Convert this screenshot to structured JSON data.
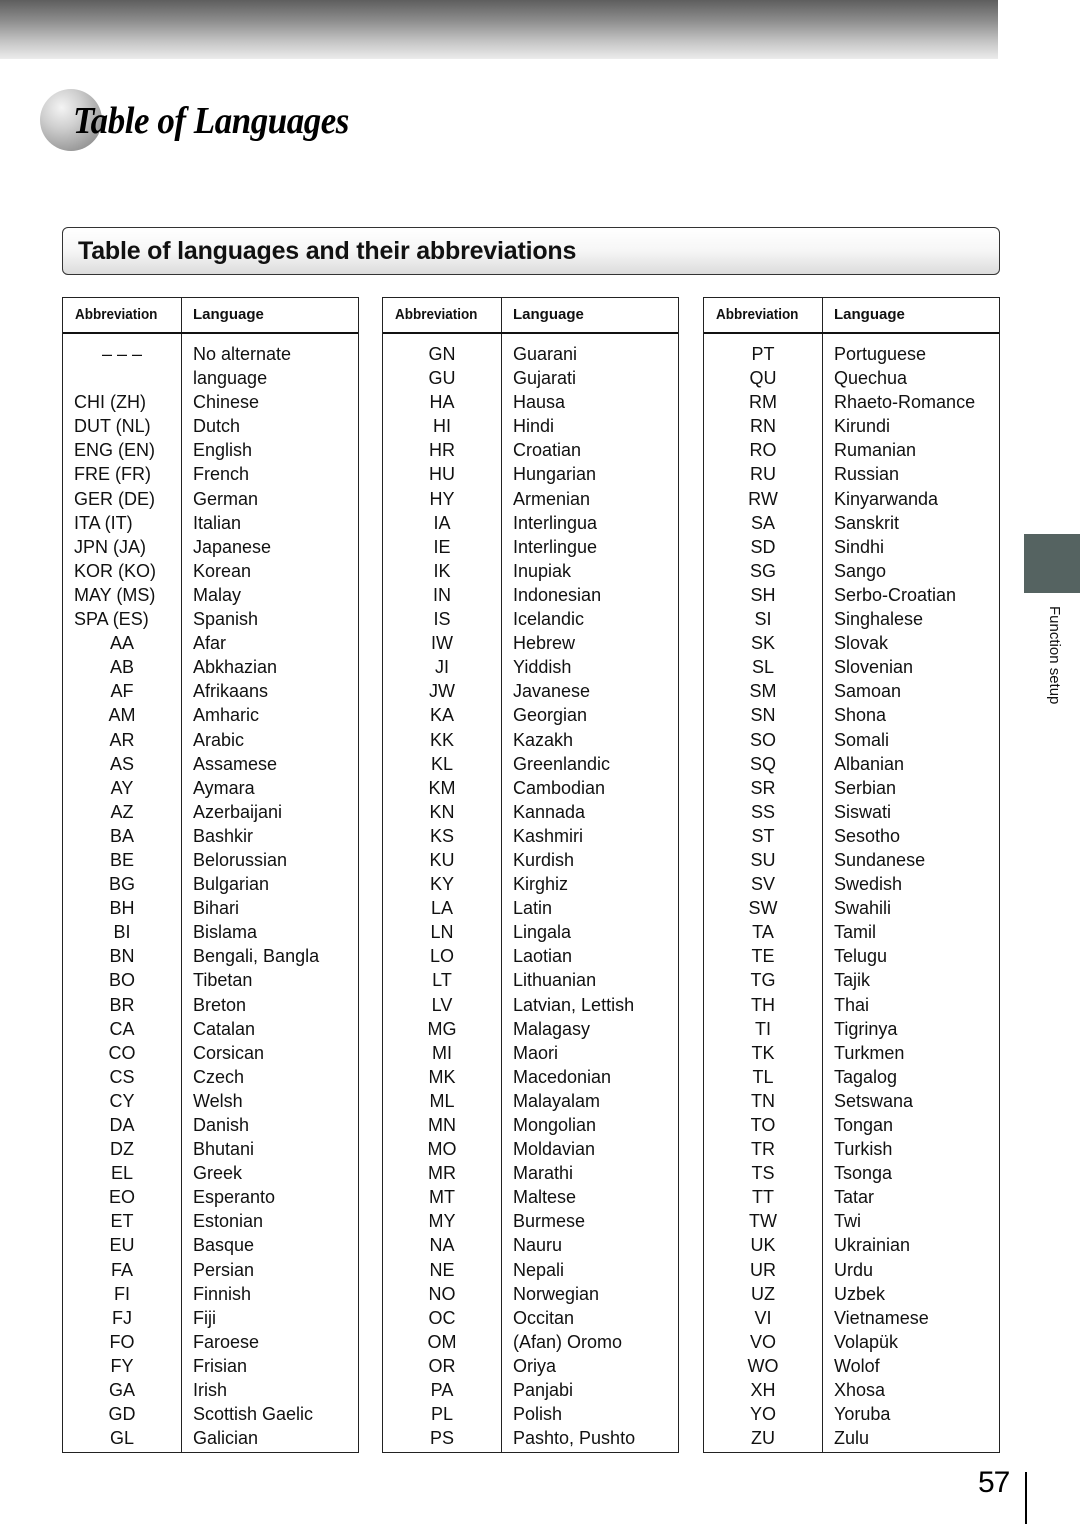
{
  "page": {
    "title": "Table of Languages",
    "section_heading": "Table of languages and their abbreviations",
    "side_tab_label": "Function setup",
    "page_number": "57"
  },
  "table_headers": {
    "abbreviation": "Abbreviation",
    "language": "Language"
  },
  "tables": [
    {
      "rows": [
        {
          "abbr": "– – –",
          "lang": "No alternate"
        },
        {
          "abbr": "",
          "lang": "language"
        },
        {
          "abbr": "CHI (ZH)",
          "lang": "Chinese"
        },
        {
          "abbr": "DUT (NL)",
          "lang": "Dutch"
        },
        {
          "abbr": "ENG (EN)",
          "lang": "English"
        },
        {
          "abbr": "FRE (FR)",
          "lang": "French"
        },
        {
          "abbr": "GER (DE)",
          "lang": "German"
        },
        {
          "abbr": "ITA (IT)",
          "lang": "Italian"
        },
        {
          "abbr": "JPN (JA)",
          "lang": "Japanese"
        },
        {
          "abbr": "KOR (KO)",
          "lang": "Korean"
        },
        {
          "abbr": "MAY (MS)",
          "lang": "Malay"
        },
        {
          "abbr": "SPA (ES)",
          "lang": "Spanish"
        },
        {
          "abbr": "AA",
          "lang": "Afar"
        },
        {
          "abbr": "AB",
          "lang": "Abkhazian"
        },
        {
          "abbr": "AF",
          "lang": "Afrikaans"
        },
        {
          "abbr": "AM",
          "lang": "Amharic"
        },
        {
          "abbr": "AR",
          "lang": "Arabic"
        },
        {
          "abbr": "AS",
          "lang": "Assamese"
        },
        {
          "abbr": "AY",
          "lang": "Aymara"
        },
        {
          "abbr": "AZ",
          "lang": "Azerbaijani"
        },
        {
          "abbr": "BA",
          "lang": "Bashkir"
        },
        {
          "abbr": "BE",
          "lang": "Belorussian"
        },
        {
          "abbr": "BG",
          "lang": "Bulgarian"
        },
        {
          "abbr": "BH",
          "lang": "Bihari"
        },
        {
          "abbr": "BI",
          "lang": "Bislama"
        },
        {
          "abbr": "BN",
          "lang": "Bengali, Bangla"
        },
        {
          "abbr": "BO",
          "lang": "Tibetan"
        },
        {
          "abbr": "BR",
          "lang": "Breton"
        },
        {
          "abbr": "CA",
          "lang": "Catalan"
        },
        {
          "abbr": "CO",
          "lang": "Corsican"
        },
        {
          "abbr": "CS",
          "lang": "Czech"
        },
        {
          "abbr": "CY",
          "lang": "Welsh"
        },
        {
          "abbr": "DA",
          "lang": "Danish"
        },
        {
          "abbr": "DZ",
          "lang": "Bhutani"
        },
        {
          "abbr": "EL",
          "lang": "Greek"
        },
        {
          "abbr": "EO",
          "lang": "Esperanto"
        },
        {
          "abbr": "ET",
          "lang": "Estonian"
        },
        {
          "abbr": "EU",
          "lang": "Basque"
        },
        {
          "abbr": "FA",
          "lang": "Persian"
        },
        {
          "abbr": "FI",
          "lang": "Finnish"
        },
        {
          "abbr": "FJ",
          "lang": "Fiji"
        },
        {
          "abbr": "FO",
          "lang": "Faroese"
        },
        {
          "abbr": "FY",
          "lang": "Frisian"
        },
        {
          "abbr": "GA",
          "lang": "Irish"
        },
        {
          "abbr": "GD",
          "lang": "Scottish Gaelic"
        },
        {
          "abbr": "GL",
          "lang": "Galician"
        }
      ]
    },
    {
      "rows": [
        {
          "abbr": "GN",
          "lang": "Guarani"
        },
        {
          "abbr": "GU",
          "lang": "Gujarati"
        },
        {
          "abbr": "HA",
          "lang": "Hausa"
        },
        {
          "abbr": "HI",
          "lang": "Hindi"
        },
        {
          "abbr": "HR",
          "lang": "Croatian"
        },
        {
          "abbr": "HU",
          "lang": "Hungarian"
        },
        {
          "abbr": "HY",
          "lang": "Armenian"
        },
        {
          "abbr": "IA",
          "lang": "Interlingua"
        },
        {
          "abbr": "IE",
          "lang": "Interlingue"
        },
        {
          "abbr": "IK",
          "lang": "Inupiak"
        },
        {
          "abbr": "IN",
          "lang": "Indonesian"
        },
        {
          "abbr": "IS",
          "lang": "Icelandic"
        },
        {
          "abbr": "IW",
          "lang": "Hebrew"
        },
        {
          "abbr": "JI",
          "lang": "Yiddish"
        },
        {
          "abbr": "JW",
          "lang": "Javanese"
        },
        {
          "abbr": "KA",
          "lang": "Georgian"
        },
        {
          "abbr": "KK",
          "lang": "Kazakh"
        },
        {
          "abbr": "KL",
          "lang": "Greenlandic"
        },
        {
          "abbr": "KM",
          "lang": "Cambodian"
        },
        {
          "abbr": "KN",
          "lang": "Kannada"
        },
        {
          "abbr": "KS",
          "lang": "Kashmiri"
        },
        {
          "abbr": "KU",
          "lang": "Kurdish"
        },
        {
          "abbr": "KY",
          "lang": "Kirghiz"
        },
        {
          "abbr": "LA",
          "lang": "Latin"
        },
        {
          "abbr": "LN",
          "lang": "Lingala"
        },
        {
          "abbr": "LO",
          "lang": "Laotian"
        },
        {
          "abbr": "LT",
          "lang": "Lithuanian"
        },
        {
          "abbr": "LV",
          "lang": "Latvian, Lettish"
        },
        {
          "abbr": "MG",
          "lang": "Malagasy"
        },
        {
          "abbr": "MI",
          "lang": "Maori"
        },
        {
          "abbr": "MK",
          "lang": "Macedonian"
        },
        {
          "abbr": "ML",
          "lang": "Malayalam"
        },
        {
          "abbr": "MN",
          "lang": "Mongolian"
        },
        {
          "abbr": "MO",
          "lang": "Moldavian"
        },
        {
          "abbr": "MR",
          "lang": "Marathi"
        },
        {
          "abbr": "MT",
          "lang": "Maltese"
        },
        {
          "abbr": "MY",
          "lang": "Burmese"
        },
        {
          "abbr": "NA",
          "lang": "Nauru"
        },
        {
          "abbr": "NE",
          "lang": "Nepali"
        },
        {
          "abbr": "NO",
          "lang": "Norwegian"
        },
        {
          "abbr": "OC",
          "lang": "Occitan"
        },
        {
          "abbr": "OM",
          "lang": "(Afan) Oromo"
        },
        {
          "abbr": "OR",
          "lang": "Oriya"
        },
        {
          "abbr": "PA",
          "lang": "Panjabi"
        },
        {
          "abbr": "PL",
          "lang": "Polish"
        },
        {
          "abbr": "PS",
          "lang": "Pashto, Pushto"
        }
      ]
    },
    {
      "rows": [
        {
          "abbr": "PT",
          "lang": "Portuguese"
        },
        {
          "abbr": "QU",
          "lang": "Quechua"
        },
        {
          "abbr": "RM",
          "lang": "Rhaeto-Romance"
        },
        {
          "abbr": "RN",
          "lang": "Kirundi"
        },
        {
          "abbr": "RO",
          "lang": "Rumanian"
        },
        {
          "abbr": "RU",
          "lang": "Russian"
        },
        {
          "abbr": "RW",
          "lang": "Kinyarwanda"
        },
        {
          "abbr": "SA",
          "lang": "Sanskrit"
        },
        {
          "abbr": "SD",
          "lang": "Sindhi"
        },
        {
          "abbr": "SG",
          "lang": "Sango"
        },
        {
          "abbr": "SH",
          "lang": "Serbo-Croatian"
        },
        {
          "abbr": "SI",
          "lang": "Singhalese"
        },
        {
          "abbr": "SK",
          "lang": "Slovak"
        },
        {
          "abbr": "SL",
          "lang": "Slovenian"
        },
        {
          "abbr": "SM",
          "lang": "Samoan"
        },
        {
          "abbr": "SN",
          "lang": "Shona"
        },
        {
          "abbr": "SO",
          "lang": "Somali"
        },
        {
          "abbr": "SQ",
          "lang": "Albanian"
        },
        {
          "abbr": "SR",
          "lang": "Serbian"
        },
        {
          "abbr": "SS",
          "lang": "Siswati"
        },
        {
          "abbr": "ST",
          "lang": "Sesotho"
        },
        {
          "abbr": "SU",
          "lang": "Sundanese"
        },
        {
          "abbr": "SV",
          "lang": "Swedish"
        },
        {
          "abbr": "SW",
          "lang": "Swahili"
        },
        {
          "abbr": "TA",
          "lang": "Tamil"
        },
        {
          "abbr": "TE",
          "lang": "Telugu"
        },
        {
          "abbr": "TG",
          "lang": "Tajik"
        },
        {
          "abbr": "TH",
          "lang": "Thai"
        },
        {
          "abbr": "TI",
          "lang": "Tigrinya"
        },
        {
          "abbr": "TK",
          "lang": "Turkmen"
        },
        {
          "abbr": "TL",
          "lang": "Tagalog"
        },
        {
          "abbr": "TN",
          "lang": "Setswana"
        },
        {
          "abbr": "TO",
          "lang": "Tongan"
        },
        {
          "abbr": "TR",
          "lang": "Turkish"
        },
        {
          "abbr": "TS",
          "lang": "Tsonga"
        },
        {
          "abbr": "TT",
          "lang": "Tatar"
        },
        {
          "abbr": "TW",
          "lang": "Twi"
        },
        {
          "abbr": "UK",
          "lang": "Ukrainian"
        },
        {
          "abbr": "UR",
          "lang": "Urdu"
        },
        {
          "abbr": "UZ",
          "lang": "Uzbek"
        },
        {
          "abbr": "VI",
          "lang": "Vietnamese"
        },
        {
          "abbr": "VO",
          "lang": "Volapük"
        },
        {
          "abbr": "WO",
          "lang": "Wolof"
        },
        {
          "abbr": "XH",
          "lang": "Xhosa"
        },
        {
          "abbr": "YO",
          "lang": "Yoruba"
        },
        {
          "abbr": "ZU",
          "lang": "Zulu"
        }
      ]
    }
  ]
}
